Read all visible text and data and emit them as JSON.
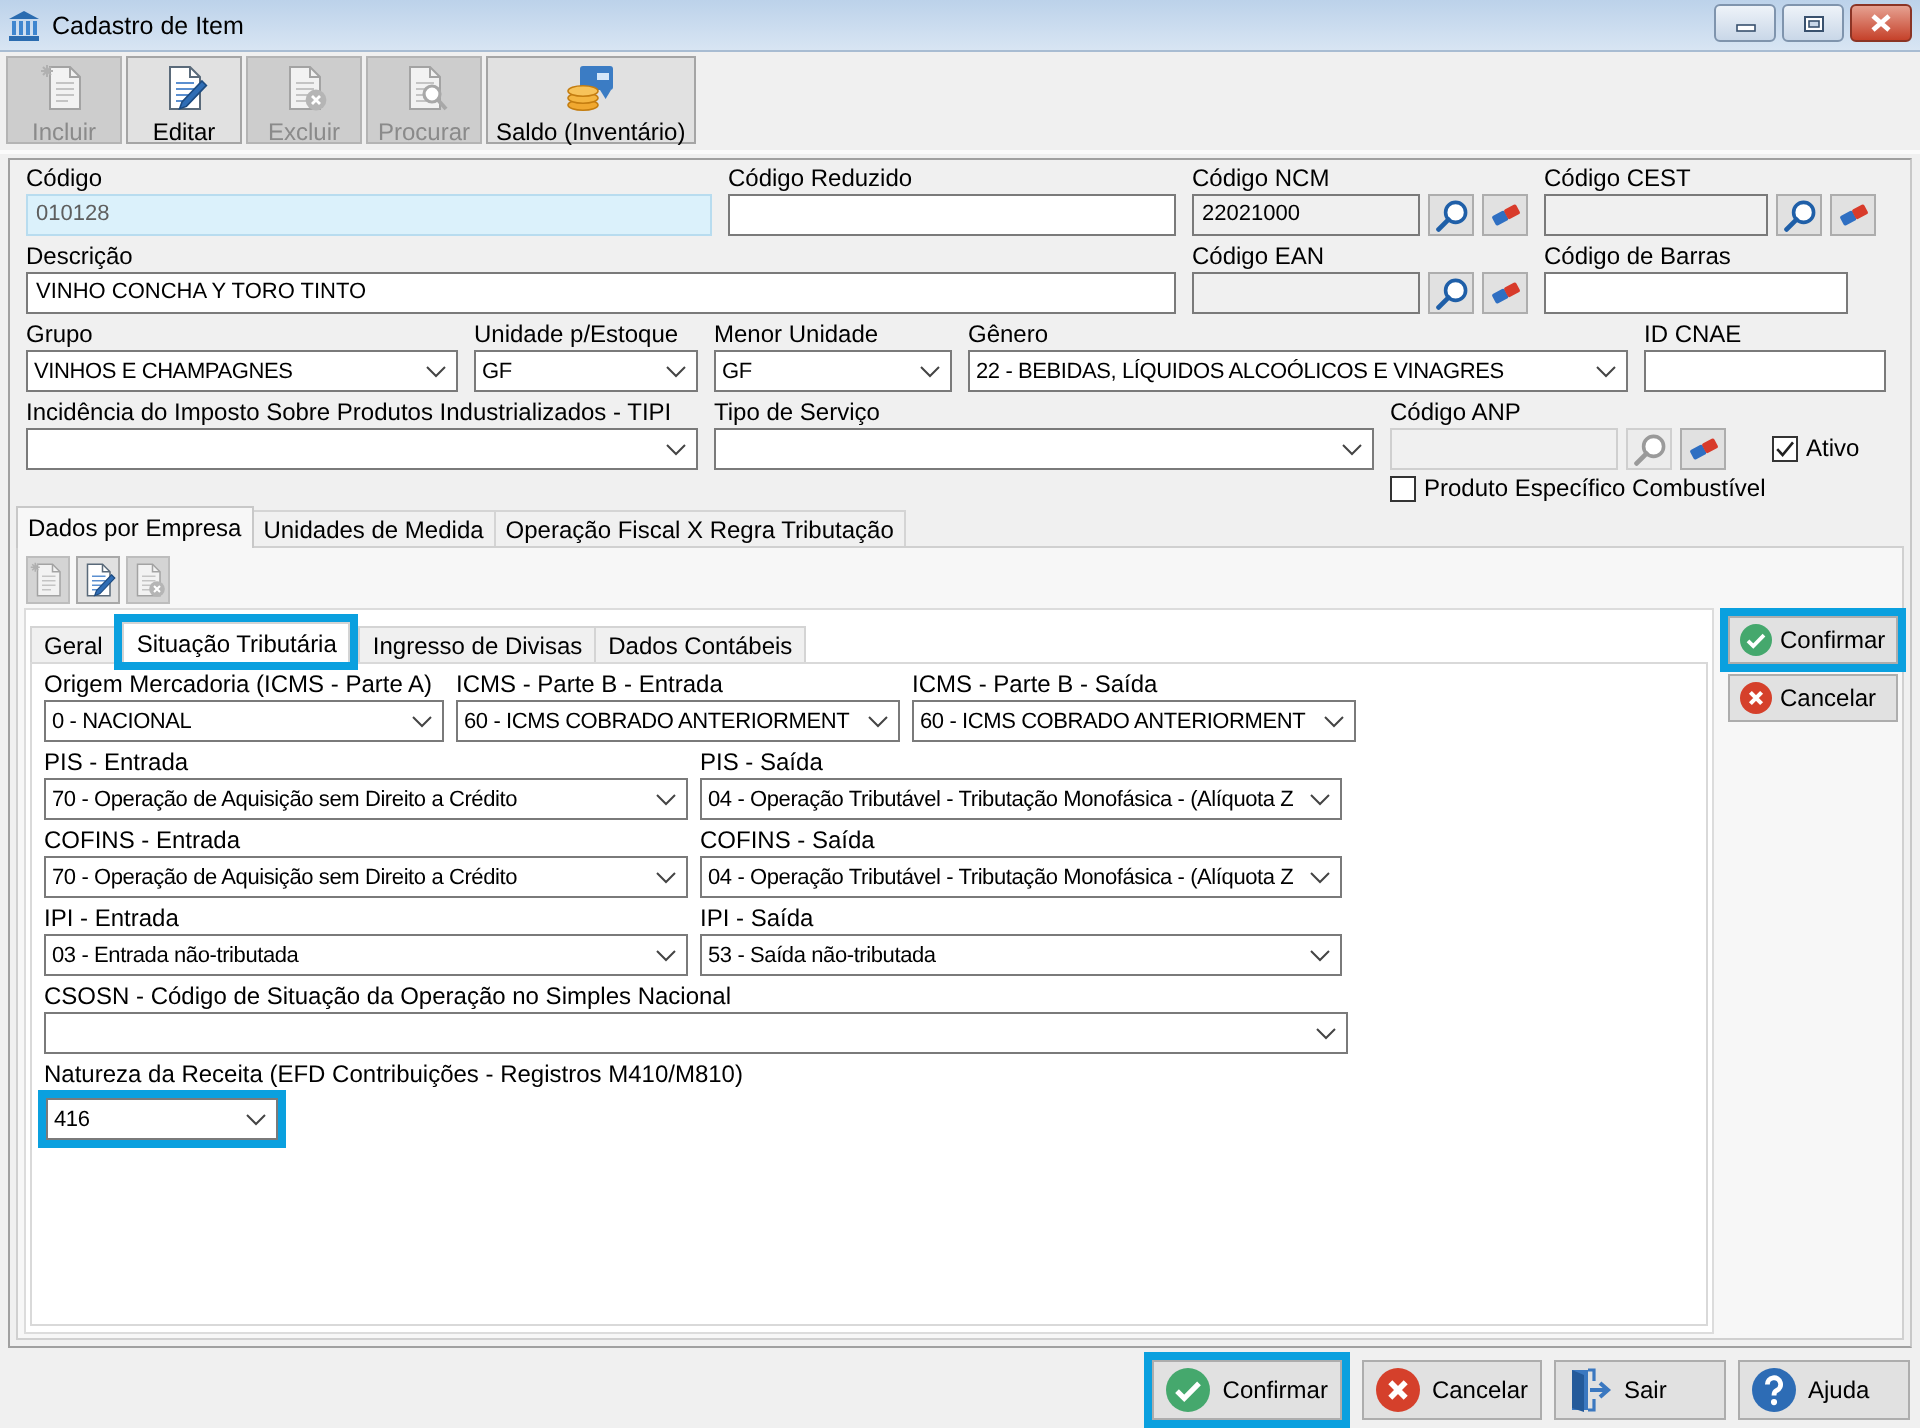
{
  "window": {
    "title": "Cadastro de Item"
  },
  "toolbar": [
    {
      "label": "Incluir",
      "kind": "new",
      "disabled": true
    },
    {
      "label": "Editar",
      "kind": "edit",
      "disabled": false
    },
    {
      "label": "Excluir",
      "kind": "delete",
      "disabled": true
    },
    {
      "label": "Procurar",
      "kind": "search",
      "disabled": true
    },
    {
      "label": "Saldo (Inventário)",
      "kind": "balance",
      "disabled": false
    }
  ],
  "header_fields": [
    {
      "label": "Código",
      "kind": "text",
      "value": "010128",
      "readonly": true
    },
    {
      "label": "Código Reduzido",
      "kind": "text",
      "readonly": false
    },
    {
      "label": "Código NCM",
      "kind": "lookup",
      "value": "22021000",
      "disabled": false
    },
    {
      "label": "Código CEST",
      "kind": "lookup",
      "disabled": false
    },
    {
      "label": "Descrição",
      "kind": "text",
      "value": "VINHO CONCHA Y TORO TINTO",
      "readonly": false
    },
    {
      "label": "Código EAN",
      "kind": "lookup",
      "disabled": false
    },
    {
      "label": "Código de Barras",
      "kind": "text",
      "readonly": false
    },
    {
      "label": "Grupo",
      "kind": "select",
      "value": "VINHOS E CHAMPAGNES"
    },
    {
      "label": "Unidade p/Estoque",
      "kind": "select",
      "value": "GF"
    },
    {
      "label": "Menor Unidade",
      "kind": "select",
      "value": "GF"
    },
    {
      "label": "Gênero",
      "kind": "select",
      "value": "22 - BEBIDAS, LÍQUIDOS ALCOÓLICOS E VINAGRES"
    },
    {
      "label": "ID CNAE",
      "kind": "text",
      "readonly": false
    },
    {
      "label": "Incidência do Imposto Sobre Produtos Industrializados - TIPI",
      "kind": "select"
    },
    {
      "label": "Tipo de Serviço",
      "kind": "select"
    },
    {
      "label": "Código ANP",
      "kind": "lookup",
      "disabled": true
    },
    {
      "label": "Ativo",
      "kind": "checkbox",
      "checked": true
    },
    {
      "label": "Produto Específico Combustível",
      "kind": "checkbox",
      "checked": false
    }
  ],
  "tabs": [
    {
      "label": "Dados por Empresa",
      "selected": true
    },
    {
      "label": "Unidades de Medida",
      "selected": false
    },
    {
      "label": "Operação Fiscal X Regra Tributação",
      "selected": false
    }
  ],
  "tab_toolbar": [
    {
      "kind": "new",
      "disabled": true
    },
    {
      "kind": "edit",
      "disabled": false
    },
    {
      "kind": "delete",
      "disabled": true
    }
  ],
  "subtabs": [
    {
      "label": "Geral",
      "selected": false,
      "highlighted": false
    },
    {
      "label": "Situação Tributária",
      "selected": true,
      "highlighted": true
    },
    {
      "label": "Ingresso de Divisas",
      "selected": false,
      "highlighted": false
    },
    {
      "label": "Dados Contábeis",
      "selected": false,
      "highlighted": false
    }
  ],
  "tax_fields": [
    [
      {
        "label": "Origem Mercadoria (ICMS - Parte A)",
        "value": "0 - NACIONAL",
        "highlighted": false
      },
      {
        "label": "ICMS - Parte B - Entrada",
        "value": "60 - ICMS COBRADO ANTERIORMENT",
        "highlighted": false
      },
      {
        "label": "ICMS - Parte B - Saída",
        "value": "60 - ICMS COBRADO ANTERIORMENT",
        "highlighted": false
      }
    ],
    [
      {
        "label": "PIS - Entrada",
        "value": "70 - Operação de Aquisição sem Direito a Crédito",
        "highlighted": false
      },
      {
        "label": "PIS - Saída",
        "value": "04 - Operação Tributável - Tributação Monofásica - (Alíquota Z",
        "highlighted": false
      }
    ],
    [
      {
        "label": "COFINS - Entrada",
        "value": "70 - Operação de Aquisição sem Direito a Crédito",
        "highlighted": false
      },
      {
        "label": "COFINS - Saída",
        "value": "04 - Operação Tributável - Tributação Monofásica - (Alíquota Z",
        "highlighted": false
      }
    ],
    [
      {
        "label": "IPI - Entrada",
        "value": "03 - Entrada não-tributada",
        "highlighted": false
      },
      {
        "label": "IPI - Saída",
        "value": "53 - Saída não-tributada",
        "highlighted": false
      }
    ],
    [
      {
        "label": "CSOSN - Código de Situação da Operação no Simples Nacional",
        "highlighted": false
      }
    ],
    [
      {
        "label": "Natureza da Receita (EFD Contribuições - Registros M410/M810)",
        "value": "416",
        "highlighted": true
      }
    ]
  ],
  "side_buttons": [
    {
      "label": "Confirmar",
      "kind": "confirm",
      "highlighted": true
    },
    {
      "label": "Cancelar",
      "kind": "cancel",
      "highlighted": false
    }
  ],
  "footer_buttons": [
    {
      "label": "Confirmar",
      "kind": "confirm",
      "highlighted": true
    },
    {
      "label": "Cancelar",
      "kind": "cancel",
      "highlighted": false
    },
    {
      "label": "Sair",
      "kind": "exit",
      "highlighted": false
    },
    {
      "label": "Ajuda",
      "kind": "help",
      "highlighted": false
    }
  ]
}
